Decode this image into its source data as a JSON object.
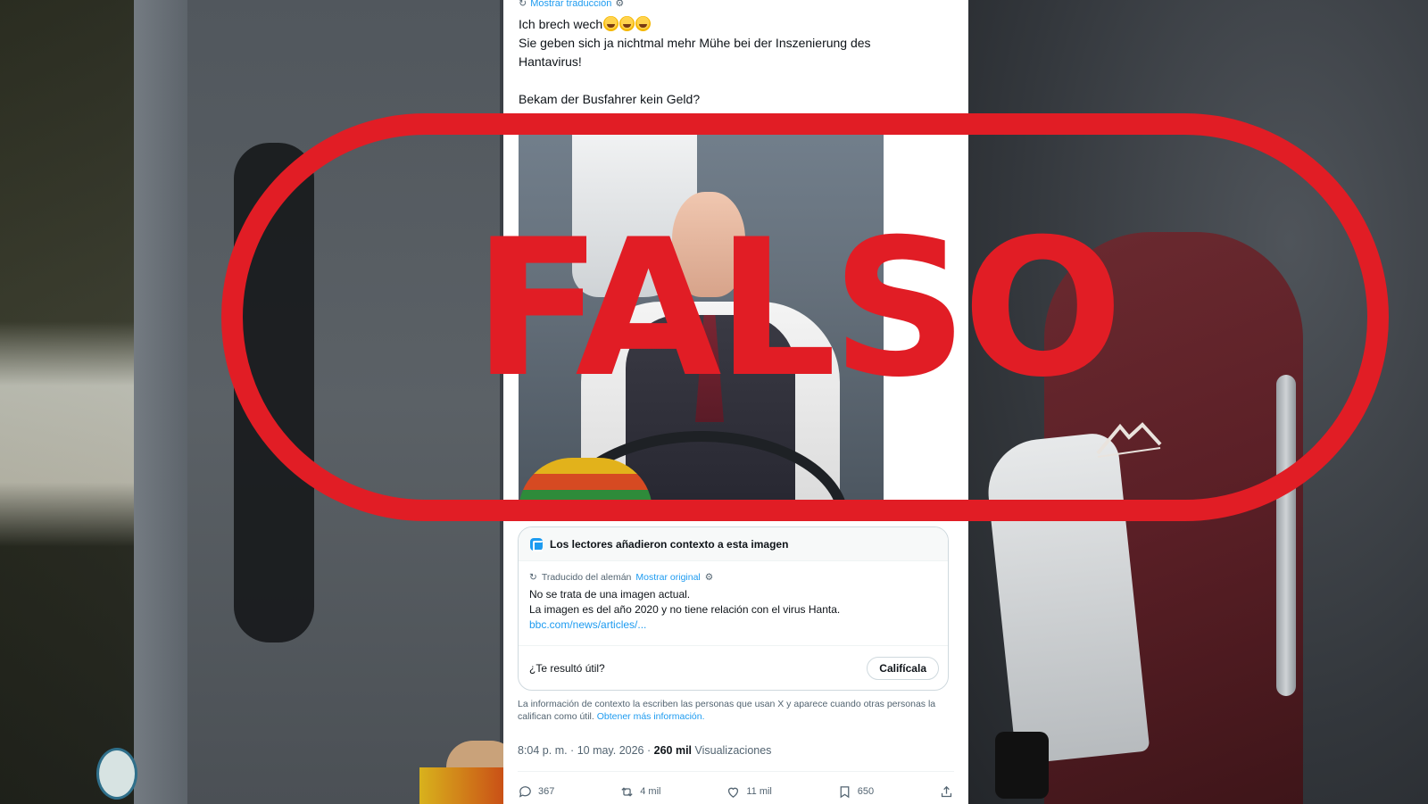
{
  "tweet": {
    "show_translation": "Mostrar traducción",
    "text_lines": [
      "Ich brech wech",
      "Sie geben sich ja nichtmal mehr Mühe bei der Inszenierung des",
      "Hantavirus!",
      "Bekam der Busfahrer kein Geld?"
    ],
    "emoji": "rolling-on-the-floor-laughing ×3",
    "timestamp": "8:04 p. m. · 10 may. 2026 · ",
    "views_count": "260 mil",
    "views_label": " Visualizaciones"
  },
  "context_note": {
    "header": "Los lectores añadieron contexto a esta imagen",
    "translated_from": "Traducido del alemán",
    "show_original": "Mostrar original",
    "line1": "No se trata de una imagen actual.",
    "line2": "La imagen es del año 2020 y no tiene relación con el virus Hanta.",
    "link": "bbc.com/news/articles/...",
    "helpful_question": "¿Te resultó útil?",
    "rate_button": "Califícala"
  },
  "disclaimer": {
    "text": "La información de contexto la escriben las personas que usan X y aparece cuando otras personas la califican como útil.",
    "link": "Obtener más información."
  },
  "actions": {
    "replies": "367",
    "reposts": "4 mil",
    "likes": "11 mil",
    "bookmarks": "650"
  },
  "stamp": {
    "text": "FALSO",
    "color": "#e11d25"
  },
  "colors": {
    "link": "#1d9bf0",
    "text": "#0f1419",
    "muted": "#536471"
  }
}
